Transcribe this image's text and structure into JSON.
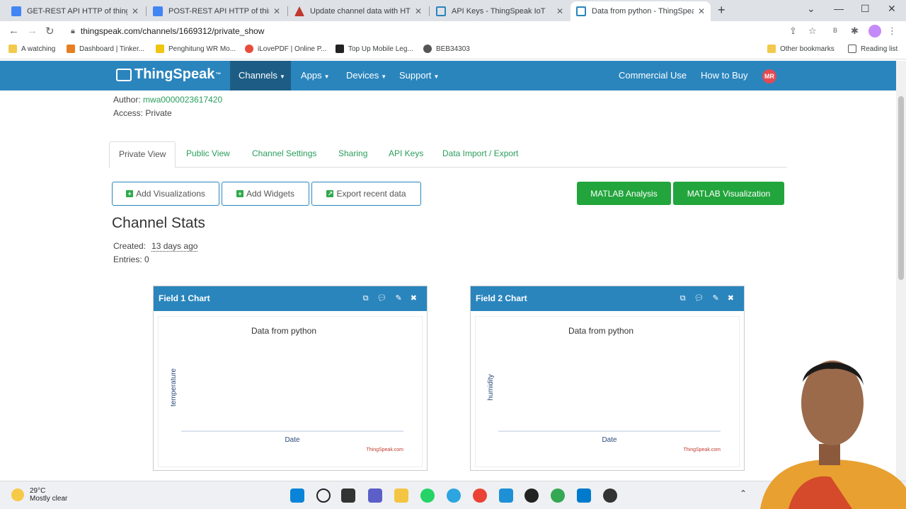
{
  "browser": {
    "tabs": [
      {
        "title": "GET-REST API HTTP of thingspeak",
        "icon_color": "#4285f4"
      },
      {
        "title": "POST-REST API HTTP of thingspeak",
        "icon_color": "#4285f4"
      },
      {
        "title": "Update channel data with HTTP GET",
        "icon_color": "#c0392b"
      },
      {
        "title": "API Keys - ThingSpeak IoT",
        "icon_color": "#2a85bd"
      },
      {
        "title": "Data from python - ThingSpeak IoT",
        "icon_color": "#2a85bd"
      }
    ],
    "new_tab": "+",
    "url": "thingspeak.com/channels/1669312/private_show",
    "bookmarks": [
      {
        "label": "A watching",
        "icon_color": "#f2c94c"
      },
      {
        "label": "Dashboard | Tinker...",
        "icon_color": "#e67e22"
      },
      {
        "label": "Penghitung WR Mo...",
        "icon_color": "#f1c40f"
      },
      {
        "label": "iLovePDF | Online P...",
        "icon_color": "#e74c3c"
      },
      {
        "label": "Top Up Mobile Leg...",
        "icon_color": "#222222"
      },
      {
        "label": "BEB34303",
        "icon_color": "#555555"
      }
    ],
    "other_bookmarks": "Other bookmarks",
    "reading_list": "Reading list"
  },
  "navbar": {
    "logo": "ThingSpeak",
    "logo_tm": "™",
    "items": [
      "Channels",
      "Apps",
      "Devices",
      "Support"
    ],
    "right_items": [
      "Commercial Use",
      "How to Buy"
    ],
    "avatar_initials": "MR"
  },
  "channel": {
    "author_label": "Author:",
    "author": "mwa0000023617420",
    "access": "Access: Private"
  },
  "page_tabs": [
    "Private View",
    "Public View",
    "Channel Settings",
    "Sharing",
    "API Keys",
    "Data Import / Export"
  ],
  "actions": {
    "add_visualizations": "Add Visualizations",
    "add_widgets": "Add Widgets",
    "export_recent": "Export recent data",
    "matlab_analysis": "MATLAB Analysis",
    "matlab_visualization": "MATLAB Visualization"
  },
  "stats": {
    "heading": "Channel Stats",
    "created_label": "Created:",
    "created_value": "13 days ago",
    "entries": "Entries: 0"
  },
  "widgets": [
    {
      "header": "Field 1 Chart",
      "title": "Data from python",
      "ylabel": "temperature",
      "xlabel": "Date",
      "credit": "ThingSpeak.com"
    },
    {
      "header": "Field 2 Chart",
      "title": "Data from python",
      "ylabel": "humidity",
      "xlabel": "Date",
      "credit": "ThingSpeak.com"
    }
  ],
  "taskbar": {
    "temp": "29°C",
    "weather": "Mostly clear"
  },
  "colors": {
    "navbar": "#2a85bd",
    "green": "#22a53c",
    "link": "#2a9d5c"
  }
}
